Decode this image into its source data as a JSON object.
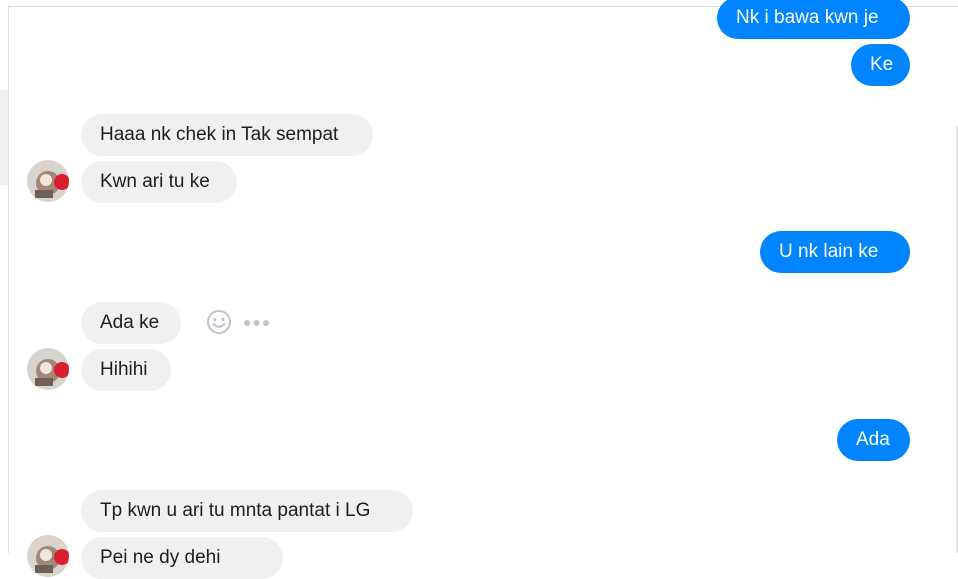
{
  "messages": {
    "m1": "Nk i bawa kwn je",
    "m2": "Ke",
    "m3": "Haaa nk chek in Tak sempat",
    "m4": "Kwn ari tu ke",
    "m5": "U  nk lain ke",
    "m6": "Ada ke",
    "m7": "Hihihi",
    "m8": "Ada",
    "m9": "Tp kwn u ari tu mnta pantat i LG",
    "m10": "Pei ne dy dehi"
  },
  "colors": {
    "outgoing_bubble": "#0084ff",
    "incoming_bubble": "#f0f0f0",
    "icon_gray": "#bec3c9"
  },
  "icons": {
    "react": "smiley-icon",
    "more": "more-horizontal-icon"
  }
}
